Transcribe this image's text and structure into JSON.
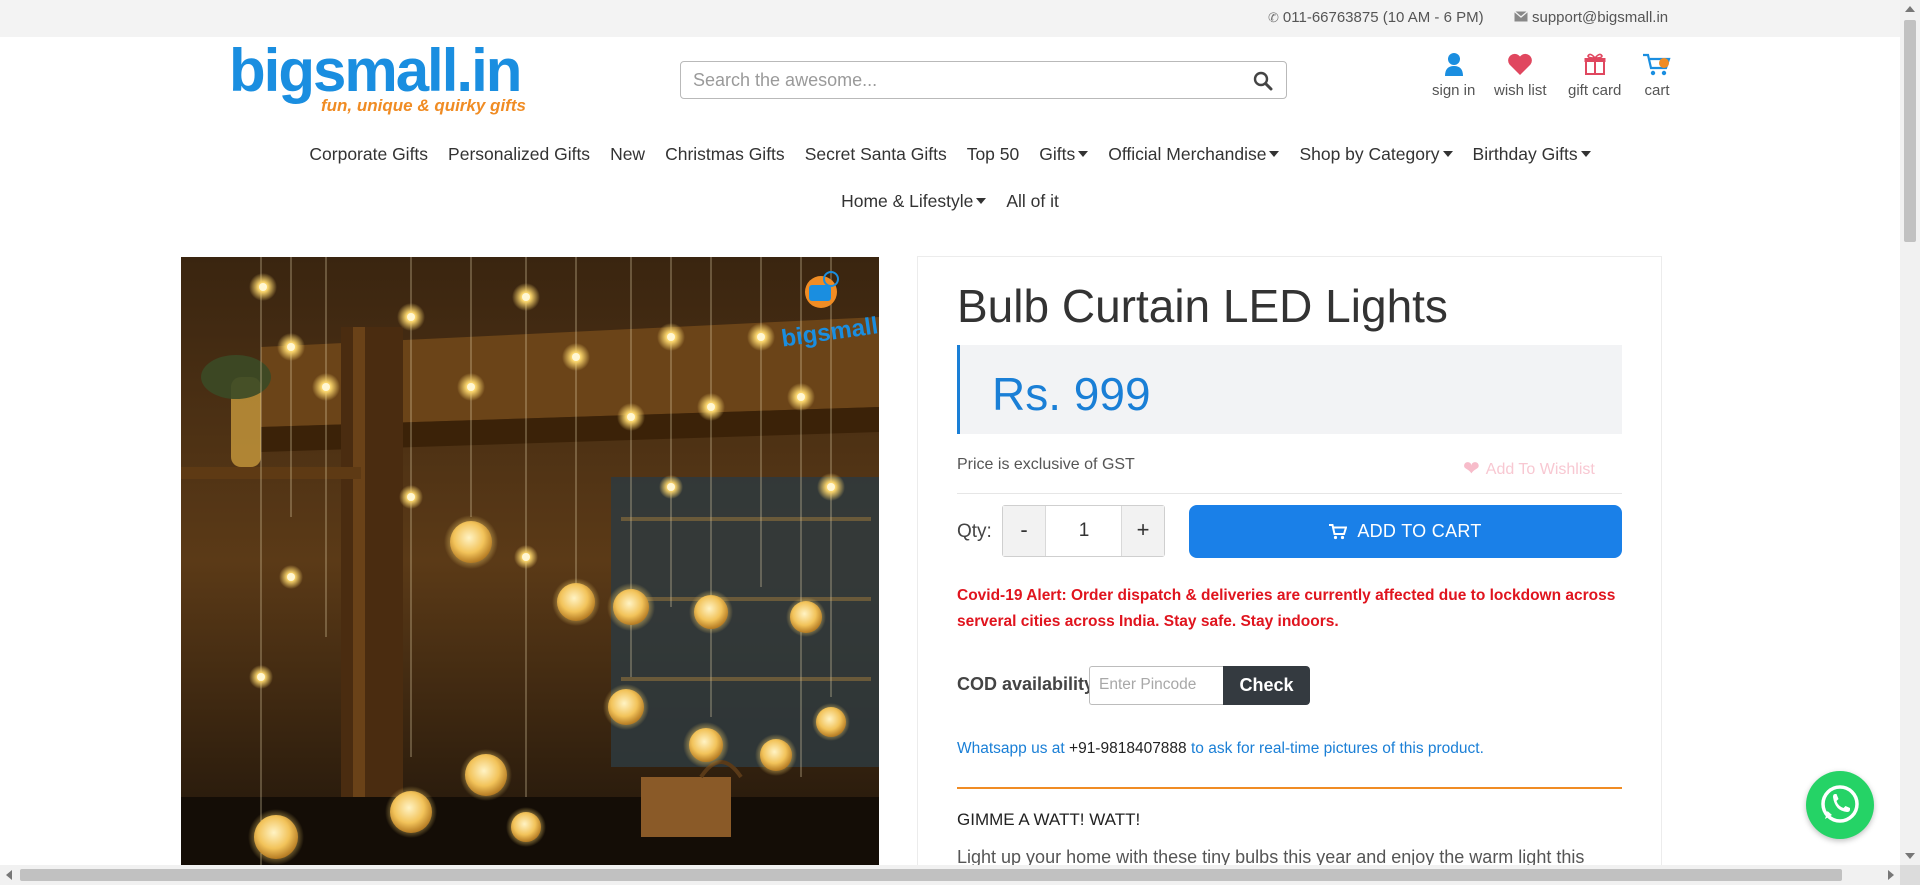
{
  "topbar": {
    "phone": "011-66763875 (10 AM - 6 PM)",
    "email": "support@bigsmall.in",
    "phone_icon": "phone-icon",
    "email_icon": "envelope-icon"
  },
  "header": {
    "logo_text": "bigsmall.in",
    "logo_tagline": "fun, unique & quirky gifts",
    "search_placeholder": "Search the awesome...",
    "icons": [
      {
        "name": "user-icon",
        "label": "sign in",
        "color": "#1a8ee0"
      },
      {
        "name": "heart-icon",
        "label": "wish list",
        "color": "#e0475f"
      },
      {
        "name": "gift-icon",
        "label": "gift card",
        "color": "#e0475f"
      },
      {
        "name": "cart-icon",
        "label": "cart",
        "color": "#1a8ee0"
      }
    ]
  },
  "nav": {
    "row1": [
      {
        "label": "Corporate Gifts",
        "dropdown": false
      },
      {
        "label": "Personalized Gifts",
        "dropdown": false
      },
      {
        "label": "New",
        "dropdown": false
      },
      {
        "label": "Christmas Gifts",
        "dropdown": false
      },
      {
        "label": "Secret Santa Gifts",
        "dropdown": false
      },
      {
        "label": "Top 50",
        "dropdown": false
      },
      {
        "label": "Gifts",
        "dropdown": true
      },
      {
        "label": "Official Merchandise",
        "dropdown": true
      },
      {
        "label": "Shop by Category",
        "dropdown": true
      },
      {
        "label": "Birthday Gifts",
        "dropdown": true
      }
    ],
    "row2": [
      {
        "label": "Home & Lifestyle",
        "dropdown": true
      },
      {
        "label": "All of it",
        "dropdown": false
      }
    ]
  },
  "product": {
    "image_watermark": "bigsmall.in",
    "title": "Bulb Curtain LED Lights",
    "price": "Rs. 999",
    "gst_note": "Price is exclusive of GST",
    "wishlist_label": "Add To Wishlist",
    "qty_label": "Qty:",
    "qty_value": "1",
    "qty_minus": "-",
    "qty_plus": "+",
    "add_to_cart": "ADD TO CART",
    "covid_alert": "Covid-19 Alert: Order dispatch & deliveries are currently affected due to lockdown across serveral cities across India. Stay safe. Stay indoors.",
    "cod_label": "COD availability",
    "pincode_placeholder": "Enter Pincode",
    "check_label": "Check",
    "whatsapp_prefix": "Whatsapp us at",
    "whatsapp_number": "+91-9818407888",
    "whatsapp_suffix": "to ask for real-time pictures of this product.",
    "subheading": "GIMME A WATT! WATT!",
    "description": "Light up your home with these tiny bulbs this year and enjoy the warm light this"
  },
  "colors": {
    "accent_blue": "#1a80e8",
    "alert_red": "#e0141e",
    "divider_orange": "#f08c24",
    "whatsapp_green": "#25d366"
  }
}
